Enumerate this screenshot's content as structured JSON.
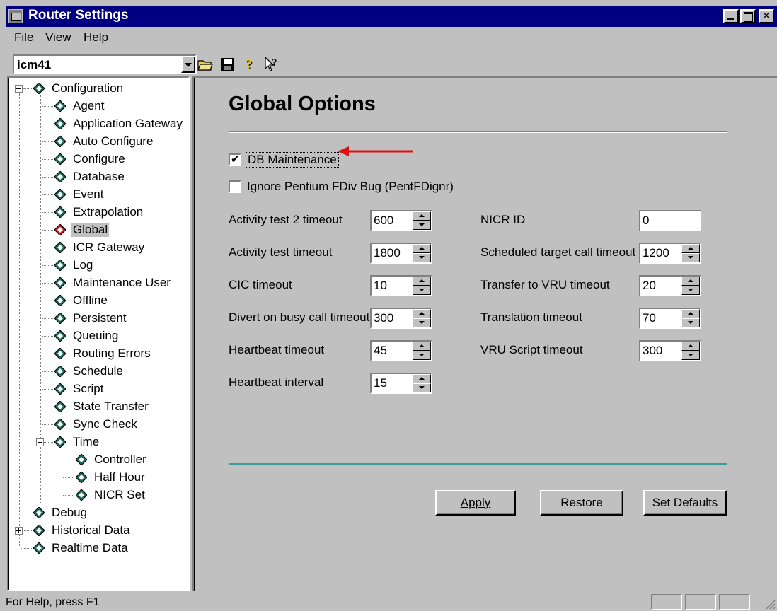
{
  "window": {
    "title": "Router Settings"
  },
  "menu": {
    "file": "File",
    "view": "View",
    "help": "Help"
  },
  "toolbar": {
    "instance_value": "icm41",
    "icons": [
      "open-folder-icon",
      "save-icon",
      "help-icon",
      "context-help-icon"
    ]
  },
  "tree": {
    "root": "Configuration",
    "items": [
      "Agent",
      "Application Gateway",
      "Auto Configure",
      "Configure",
      "Database",
      "Event",
      "Extrapolation",
      "Global",
      "ICR Gateway",
      "Log",
      "Maintenance User",
      "Offline",
      "Persistent",
      "Queuing",
      "Routing Errors",
      "Schedule",
      "Script",
      "State Transfer",
      "Sync Check",
      "Time"
    ],
    "time_children": [
      "Controller",
      "Half Hour",
      "NICR Set"
    ],
    "other_roots": [
      "Debug",
      "Historical Data",
      "Realtime Data"
    ],
    "selected": "Global"
  },
  "main": {
    "title": "Global Options",
    "db_maintenance": {
      "label": "DB Maintenance",
      "checked": true
    },
    "ignore_pentium": {
      "label": "Ignore Pentium FDiv Bug (PentFDignr)",
      "checked": false
    },
    "left_fields": [
      {
        "label": "Activity test 2 timeout",
        "value": "600"
      },
      {
        "label": "Activity test timeout",
        "value": "1800"
      },
      {
        "label": "CIC timeout",
        "value": "10"
      },
      {
        "label": "Divert on busy call timeout",
        "value": "300"
      },
      {
        "label": "Heartbeat timeout",
        "value": "45"
      },
      {
        "label": "Heartbeat interval",
        "value": "15"
      }
    ],
    "right_fields": [
      {
        "label": "NICR ID",
        "value": "0"
      },
      {
        "label": "Scheduled target call timeout",
        "value": "1200"
      },
      {
        "label": "Transfer to VRU timeout",
        "value": "20"
      },
      {
        "label": "Translation timeout",
        "value": "70"
      },
      {
        "label": "VRU Script timeout",
        "value": "300"
      }
    ],
    "buttons": {
      "apply": "Apply",
      "restore": "Restore",
      "set_defaults": "Set Defaults"
    }
  },
  "status": {
    "text": "For Help, press F1"
  },
  "colors": {
    "titlebar": "#000080",
    "rule": "#3a9e9a",
    "annotation_arrow": "#e01010",
    "diamond": "#1a6b5a"
  }
}
